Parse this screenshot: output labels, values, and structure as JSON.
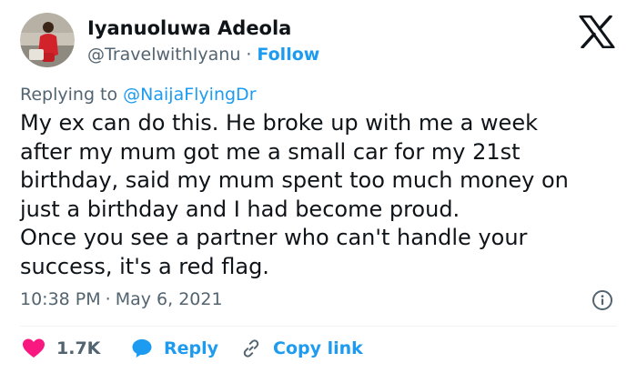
{
  "author": {
    "display_name": "Iyanuoluwa Adeola",
    "handle": "@TravelwithIyanu",
    "separator": "·",
    "follow_label": "Follow"
  },
  "reply_context": {
    "prefix": "Replying to",
    "target": "@NaijaFlyingDr"
  },
  "tweet": {
    "lines": [
      "My ex can do this. He broke up with me a week",
      "after my mum got me a small car for my 21st",
      "birthday, said my mum spent too much money on",
      "just a birthday and I had become proud.",
      "Once you see a partner who can't handle your",
      "success, it's a red flag."
    ],
    "time": "10:38 PM",
    "separator": "·",
    "date": "May 6, 2021"
  },
  "actions": {
    "likes_count": "1.7K",
    "reply_label": "Reply",
    "copy_link_label": "Copy link"
  },
  "icons": {
    "brand": "x-logo-icon",
    "info": "info-icon",
    "like": "heart-icon",
    "reply": "speech-bubble-icon",
    "copy": "link-icon"
  },
  "colors": {
    "text": "#0f1419",
    "secondary": "#536471",
    "accent": "#1d9bf0",
    "heart": "#f91880"
  }
}
